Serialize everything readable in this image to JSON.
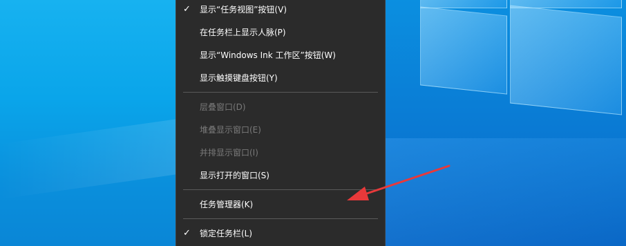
{
  "menu": {
    "items": [
      {
        "label": "显示“任务视图”按钮(V)",
        "checked": true,
        "disabled": false
      },
      {
        "label": "在任务栏上显示人脉(P)",
        "checked": false,
        "disabled": false
      },
      {
        "label": "显示“Windows Ink 工作区”按钮(W)",
        "checked": false,
        "disabled": false
      },
      {
        "label": "显示触摸键盘按钮(Y)",
        "checked": false,
        "disabled": false
      },
      {
        "label": "层叠窗口(D)",
        "checked": false,
        "disabled": true
      },
      {
        "label": "堆叠显示窗口(E)",
        "checked": false,
        "disabled": true
      },
      {
        "label": "并排显示窗口(I)",
        "checked": false,
        "disabled": true
      },
      {
        "label": "显示打开的窗口(S)",
        "checked": false,
        "disabled": false
      },
      {
        "label": "任务管理器(K)",
        "checked": false,
        "disabled": false
      },
      {
        "label": "锁定任务栏(L)",
        "checked": true,
        "disabled": false
      }
    ],
    "check_glyph": "✓"
  },
  "annotation": {
    "arrow_color": "#e8393a",
    "points_to": "任务管理器(K)"
  }
}
